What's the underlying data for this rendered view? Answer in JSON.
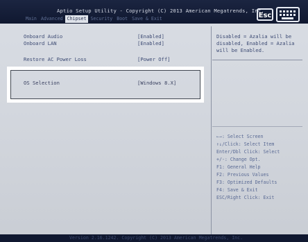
{
  "header": {
    "title": "Aptio Setup Utility - Copyright (C) 2013 American Megatrends, Inc.",
    "tabs": [
      "Main",
      "Advanced",
      "Chipset",
      "Security",
      "Boot",
      "Save & Exit"
    ],
    "active_tab": "Chipset",
    "esc_label": "Esc"
  },
  "settings": [
    {
      "label": "Onboard Audio",
      "value": "[Enabled]"
    },
    {
      "label": "Onboard LAN",
      "value": "[Enabled]"
    },
    {
      "label": "Restore AC Power Loss",
      "value": "[Power Off]"
    },
    {
      "label": "OS Selection",
      "value": "[Windows 8.X]"
    }
  ],
  "help": {
    "description": "Disabled = Azalia will be disabled,  Enabled = Azalia will be Enabled.",
    "keys": [
      "←→: Select Screen",
      "↑↓/Click: Select Item",
      "Enter/Dbl Click: Select",
      "+/-: Change Opt.",
      "F1: General Help",
      "F2: Previous Values",
      "F3: Optimized Defaults",
      "F4: Save & Exit",
      "ESC/Right Click: Exit"
    ]
  },
  "footer": {
    "text": "Version 2.16.1242. Copyright (C) 2013 American Megatrends, Inc."
  },
  "colors": {
    "header_bg": "#1b2541",
    "panel_bg": "#d6dae1",
    "text": "#3c4a73",
    "highlight_border": "#ffffff"
  }
}
